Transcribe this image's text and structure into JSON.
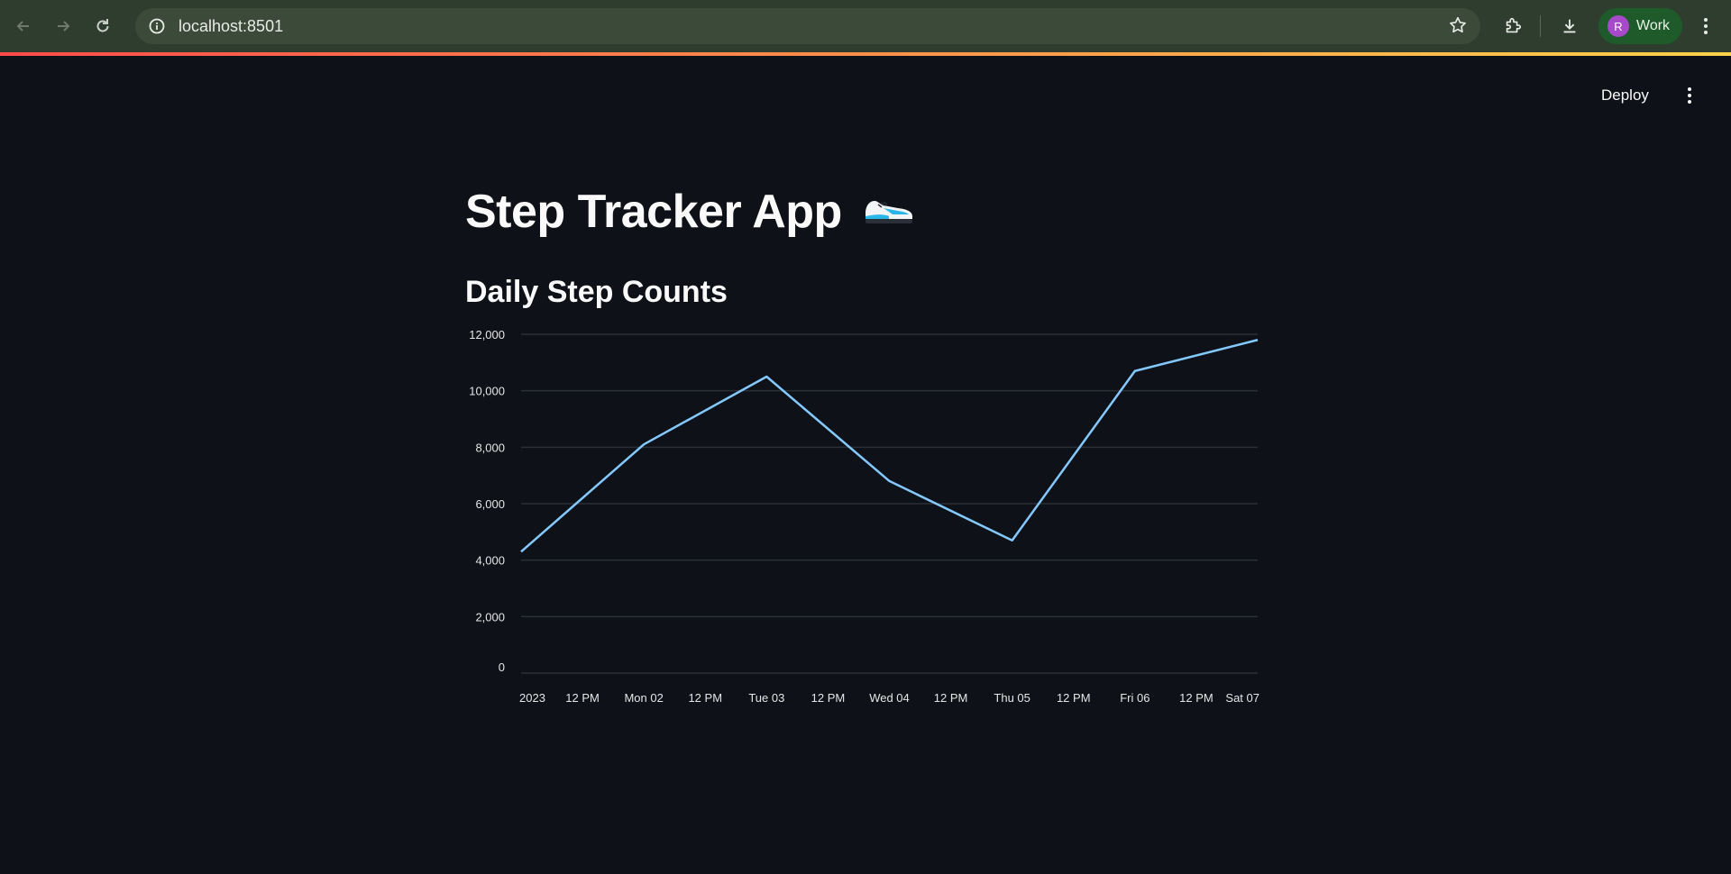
{
  "browser": {
    "url": "localhost:8501",
    "profile_initial": "R",
    "profile_label": "Work"
  },
  "header": {
    "deploy_label": "Deploy"
  },
  "main": {
    "title": "Step Tracker App",
    "subheader": "Daily Step Counts"
  },
  "colors": {
    "background": "#0e1117",
    "line": "#83c9ff",
    "grid": "#2b2f38"
  },
  "icons": [
    "back-arrow-icon",
    "forward-arrow-icon",
    "reload-icon",
    "site-info-icon",
    "star-icon",
    "extensions-icon",
    "download-icon",
    "kebab-menu-icon",
    "shoe-icon"
  ],
  "chart_data": {
    "type": "line",
    "title": "",
    "xlabel": "",
    "ylabel": "",
    "x": [
      "2023-01-01",
      "2023-01-02",
      "2023-01-03",
      "2023-01-04",
      "2023-01-05",
      "2023-01-06",
      "2023-01-07"
    ],
    "values": [
      4300,
      8100,
      10500,
      6800,
      4700,
      10700,
      11800
    ],
    "ylim": [
      0,
      12000
    ],
    "y_ticks": [
      "0",
      "2,000",
      "4,000",
      "6,000",
      "8,000",
      "10,000",
      "12,000"
    ],
    "x_ticks": [
      "2023",
      "12 PM",
      "Mon 02",
      "12 PM",
      "Tue 03",
      "12 PM",
      "Wed 04",
      "12 PM",
      "Thu 05",
      "12 PM",
      "Fri 06",
      "12 PM",
      "Sat 07"
    ],
    "grid": true,
    "legend": "none"
  }
}
